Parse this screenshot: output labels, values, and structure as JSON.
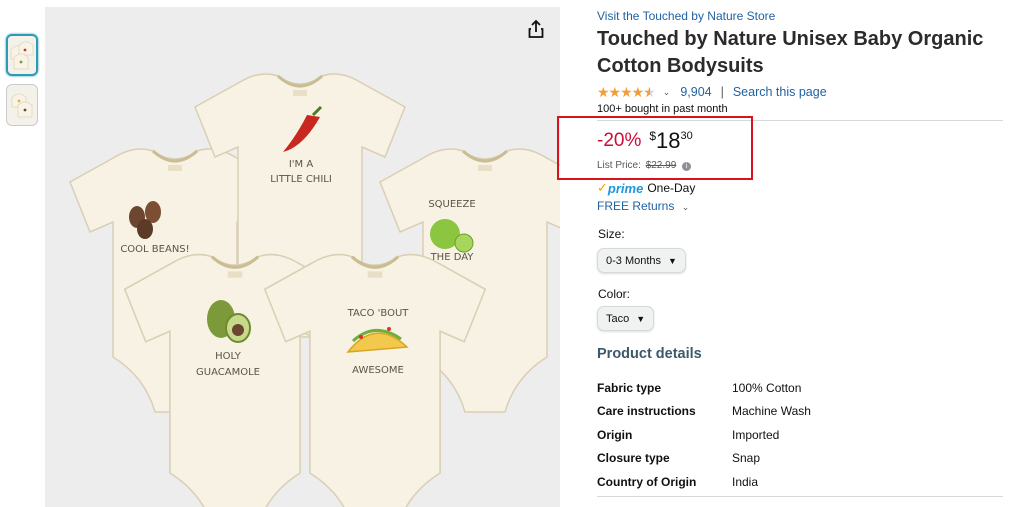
{
  "store_link": "Visit the Touched by Nature Store",
  "title": "Touched by Nature Unisex Baby Organic Cotton Bodysuits",
  "rating": {
    "stars": 4.5,
    "count": "9,904",
    "search_link": "Search this page"
  },
  "bought": "100+ bought in past month",
  "price": {
    "discount": "-20%",
    "symbol": "$",
    "whole": "18",
    "fraction": "30",
    "list_label": "List Price:",
    "list_value": "$22.99"
  },
  "prime": {
    "word": "prime",
    "speed": "One-Day"
  },
  "returns": "FREE Returns",
  "size": {
    "label": "Size:",
    "value": "0-3 Months"
  },
  "color": {
    "label": "Color:",
    "value": "Taco"
  },
  "product_details": {
    "heading": "Product details",
    "rows": [
      {
        "key": "Fabric type",
        "value": "100% Cotton"
      },
      {
        "key": "Care instructions",
        "value": "Machine Wash"
      },
      {
        "key": "Origin",
        "value": "Imported"
      },
      {
        "key": "Closure type",
        "value": "Snap"
      },
      {
        "key": "Country of Origin",
        "value": "India"
      }
    ]
  },
  "image_text": {
    "chili": [
      "I'M A",
      "LITTLE CHILI"
    ],
    "beans": "COOL BEANS!",
    "lime": [
      "SQUEEZE",
      "THE DAY"
    ],
    "avocado": [
      "HOLY",
      "GUACAMOLE"
    ],
    "taco": [
      "TACO 'BOUT",
      "AWESOME"
    ]
  },
  "colors": {
    "link": "#2162a1",
    "discount": "#cc0c39",
    "highlight_box": "#d7131c",
    "star": "#f19e38",
    "prime": "#1d98d6"
  },
  "icons": {
    "share": "share-icon",
    "info": "info-icon",
    "prime_check": "prime-check-icon"
  }
}
